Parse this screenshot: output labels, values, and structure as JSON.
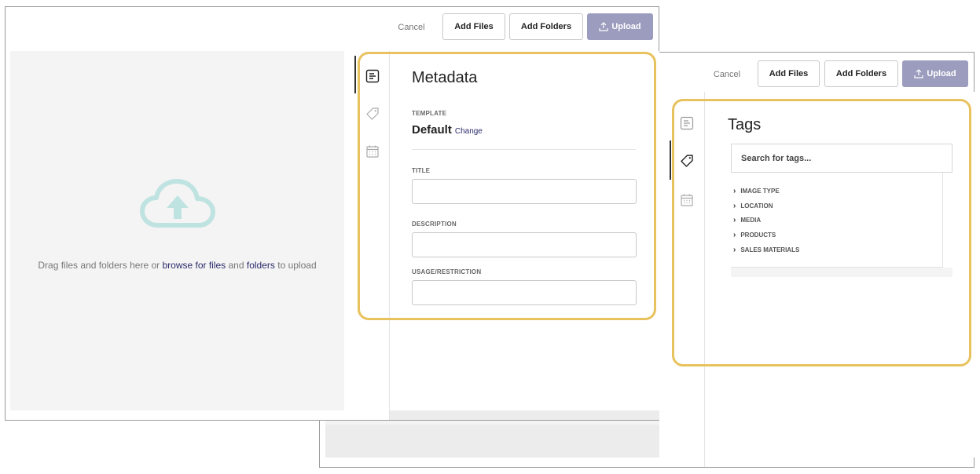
{
  "colors": {
    "highlight": "#e8c25e",
    "upload_button": "#9c9cbf",
    "link": "#2a2a6b",
    "cloud_icon": "#bfe3e1"
  },
  "front_window": {
    "toolbar": {
      "cancel": "Cancel",
      "add_files": "Add Files",
      "add_folders": "Add Folders",
      "upload": "Upload"
    },
    "dropzone": {
      "icon": "cloud-upload-icon",
      "text_prefix": "Drag files and folders here or ",
      "browse_link": "browse for files",
      "and_text": " and ",
      "folders_link": "folders",
      "suffix": " to upload"
    },
    "rail": [
      "metadata-icon",
      "tag-icon",
      "calendar-icon"
    ],
    "metadata": {
      "title": "Metadata",
      "template_label": "TEMPLATE",
      "template_value": "Default",
      "change_link": "Change",
      "fields": [
        {
          "label": "TITLE",
          "value": ""
        },
        {
          "label": "DESCRIPTION",
          "value": ""
        },
        {
          "label": "USAGE/RESTRICTION",
          "value": ""
        }
      ]
    }
  },
  "back_window": {
    "toolbar": {
      "cancel": "Cancel",
      "add_files": "Add Files",
      "add_folders": "Add Folders",
      "upload": "Upload"
    },
    "rail": [
      "metadata-icon",
      "tag-icon",
      "calendar-icon"
    ],
    "tags": {
      "title": "Tags",
      "search_placeholder": "Search for tags...",
      "items": [
        "IMAGE TYPE",
        "LOCATION",
        "MEDIA",
        "PRODUCTS",
        "SALES MATERIALS"
      ]
    }
  }
}
